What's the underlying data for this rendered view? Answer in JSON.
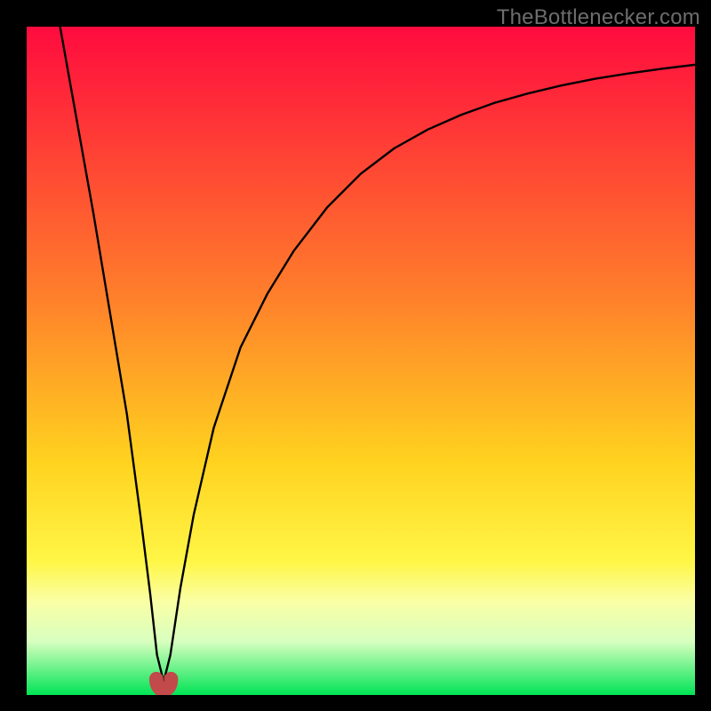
{
  "watermark": "TheBottlenecker.com",
  "colors": {
    "frame": "#000000",
    "gradient_top": "#ff0b3e",
    "gradient_40": "#ff7e2b",
    "gradient_65": "#ffd21f",
    "gradient_80": "#fff646",
    "gradient_86": "#faffa5",
    "gradient_92": "#d8ffbf",
    "gradient_bottom": "#00e455",
    "curve": "#000000",
    "marker_fill": "#c24a4a",
    "marker_outline": "#c24a4a"
  },
  "chart_data": {
    "type": "line",
    "title": "",
    "xlabel": "",
    "ylabel": "",
    "xlim": [
      0,
      100
    ],
    "ylim": [
      0,
      100
    ],
    "series": [
      {
        "name": "bottleneck-curve",
        "x": [
          5,
          7.5,
          10,
          12.5,
          15,
          17,
          18.5,
          19.5,
          20.5,
          21.5,
          23,
          25,
          28,
          32,
          36,
          40,
          45,
          50,
          55,
          60,
          65,
          70,
          75,
          80,
          85,
          90,
          95,
          100
        ],
        "values": [
          100,
          86,
          72,
          57,
          42,
          27,
          15,
          6,
          2,
          6,
          16,
          27,
          40,
          52,
          60,
          66.5,
          73,
          78,
          81.8,
          84.6,
          86.8,
          88.6,
          90,
          91.2,
          92.2,
          93,
          93.7,
          94.3
        ]
      }
    ],
    "markers": [
      {
        "name": "optimal-low",
        "x": 19.4,
        "y": 2.4
      },
      {
        "name": "optimal-high",
        "x": 21.6,
        "y": 2.4
      }
    ],
    "marker_link": {
      "from": 0,
      "to": 1,
      "dip_y": 0.2
    }
  }
}
